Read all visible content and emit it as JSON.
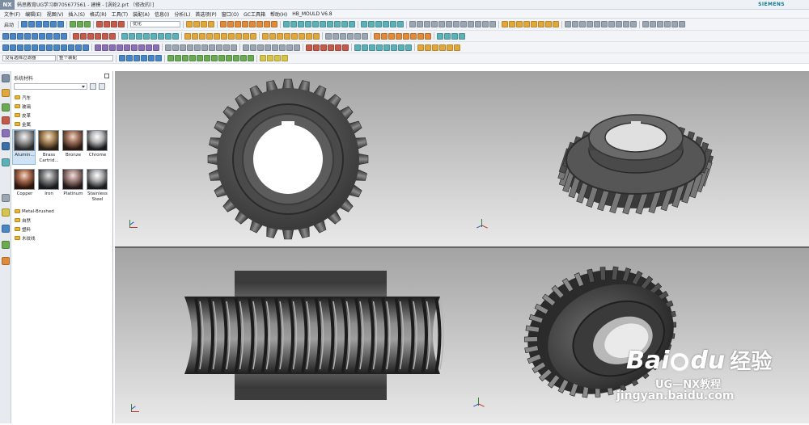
{
  "title_bar": {
    "logo": "NX",
    "title": "蚂思教育UG学习群705677561 - 建模 - [涡轮2.prt （修改的）]",
    "brand": "SIEMENS"
  },
  "menu": [
    "文件(F)",
    "编辑(E)",
    "视图(V)",
    "插入(S)",
    "格式(R)",
    "工具(T)",
    "装配(A)",
    "信息(I)",
    "分析(L)",
    "首选项(P)",
    "窗口(O)",
    "GC工具箱",
    "帮助(H)",
    "HB_MOULD V6.8"
  ],
  "toolbar": {
    "start_label": "启动",
    "render_mode_value": "优化",
    "selection_filter_value": "没有选择过滤器",
    "assembly_scope_value": "整个装配"
  },
  "colors": {
    "accent": "#0b7a8f",
    "folder": "#e7b63c",
    "viewport_top": "#a3a3a3",
    "viewport_bottom": "#e9e9e9"
  },
  "resource_bar_icons": [
    "nx-icon",
    "assembly-navigator-icon",
    "constraint-navigator-icon",
    "part-navigator-icon",
    "reuse-library-icon",
    "hd3d-tools-icon",
    "web-browser-icon",
    "history-icon",
    "process-studio-icon",
    "system-materials-icon",
    "roles-icon",
    "system-scenes-icon"
  ],
  "materials_panel": {
    "title": "系统材料",
    "top_folders": [
      "汽车",
      "玻璃",
      "皮革",
      "金属"
    ],
    "materials_row1": [
      "Alumin...",
      "Brass Cartrid...",
      "Bronze",
      "Chrome"
    ],
    "materials_row2": [
      "Copper",
      "Iron",
      "Platinum",
      "Stainless Steel"
    ],
    "bottom_folders": [
      "Metal-Brushed",
      "自然",
      "塑料",
      "木纹线"
    ]
  },
  "watermark": {
    "brand": "Bai",
    "brand2": "du",
    "text": "经验",
    "url": "jingyan.baidu.com",
    "caption": "UG—NX教程"
  }
}
